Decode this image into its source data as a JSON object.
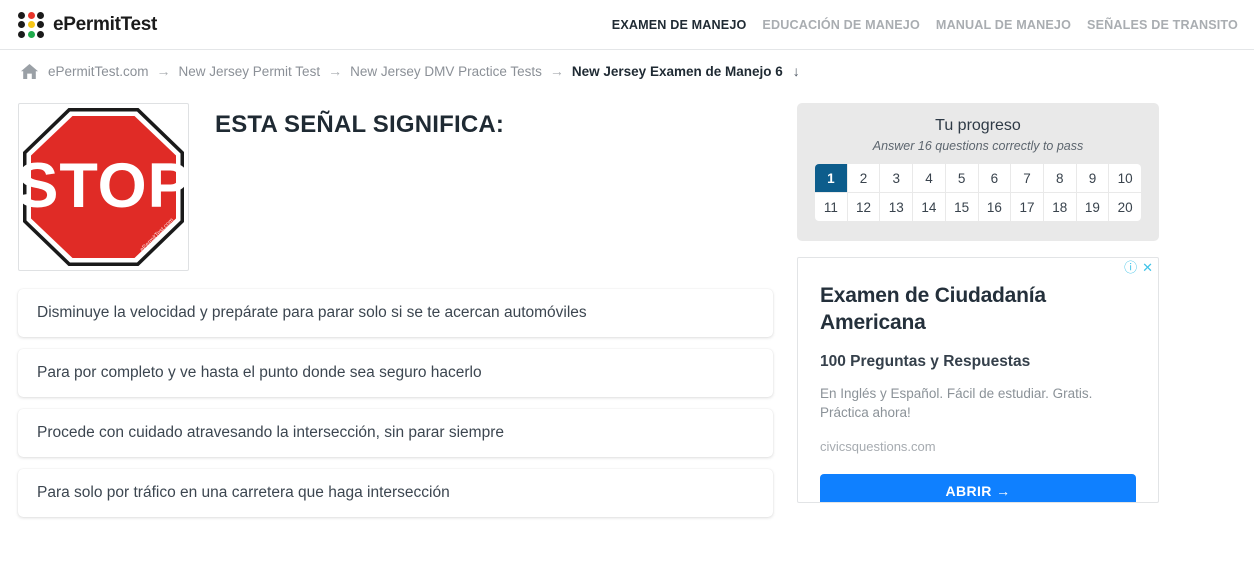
{
  "header": {
    "logo_text": "ePermitTest",
    "nav": [
      {
        "label": "EXAMEN DE MANEJO",
        "active": true
      },
      {
        "label": "EDUCACIÓN DE MANEJO",
        "active": false
      },
      {
        "label": "MANUAL DE MANEJO",
        "active": false
      },
      {
        "label": "SEÑALES DE TRANSITO",
        "active": false
      }
    ]
  },
  "breadcrumb": {
    "items": [
      {
        "label": "ePermitTest.com",
        "current": false
      },
      {
        "label": "New Jersey Permit Test",
        "current": false
      },
      {
        "label": "New Jersey DMV Practice Tests",
        "current": false
      },
      {
        "label": "New Jersey Examen de Manejo 6",
        "current": true
      }
    ],
    "separator": "→",
    "trailing_arrow": "↓"
  },
  "question": {
    "title": "ESTA SEÑAL SIGNIFICA:",
    "sign_text": "STOP",
    "sign_watermark": "ePermitTest.com",
    "answers": [
      "Disminuye la velocidad y prepárate para parar solo si se te acercan automóviles",
      "Para por completo y ve hasta el punto donde sea seguro hacerlo",
      "Procede con cuidado atravesando la intersección, sin parar siempre",
      "Para solo por tráfico en una carretera que haga intersección"
    ]
  },
  "progress": {
    "title": "Tu progreso",
    "subtitle": "Answer 16 questions correctly to pass",
    "current": 1,
    "questions": [
      1,
      2,
      3,
      4,
      5,
      6,
      7,
      8,
      9,
      10,
      11,
      12,
      13,
      14,
      15,
      16,
      17,
      18,
      19,
      20
    ]
  },
  "ad": {
    "info_icon": "ⓘ",
    "close_icon": "✕",
    "headline": "Examen de Ciudadanía Americana",
    "subhead": "100 Preguntas y Respuestas",
    "description": "En Inglés y Español. Fácil de estudiar. Gratis. Práctica ahora!",
    "url": "civicsquestions.com",
    "cta": "ABRIR →"
  },
  "colors": {
    "accent_blue": "#0d5d8c",
    "ad_blue": "#0f80ff",
    "sign_red": "#e02b26",
    "panel_gray": "#e9e9e9"
  }
}
